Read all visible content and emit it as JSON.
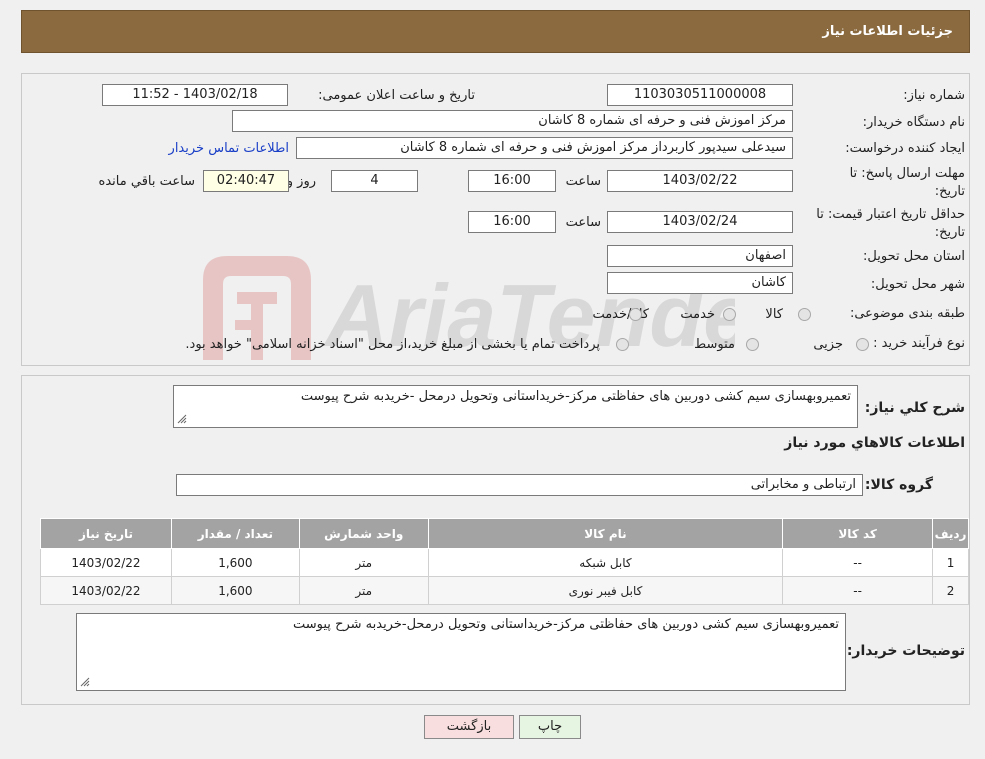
{
  "header": {
    "title": "جزئیات اطلاعات نیاز"
  },
  "details": {
    "need_number_label": "شماره نیاز:",
    "need_number": "1103030511000008",
    "announce_label": "تاریخ و ساعت اعلان عمومی:",
    "announce_value": "1403/02/18 - 11:52",
    "buyer_org_label": "نام دستگاه خریدار:",
    "buyer_org": "مرکز اموزش فنی و حرفه ای شماره 8  کاشان",
    "requester_label": "ایجاد کننده درخواست:",
    "requester": "سیدعلی سیدپور کاربرداز مرکز اموزش فنی و حرفه ای شماره 8  کاشان",
    "contact_link": "اطلاعات تماس خریدار",
    "deadline_label_1": "مهلت ارسال پاسخ: تا",
    "deadline_label_2": "تاریخ:",
    "deadline_date": "1403/02/22",
    "time_label": "ساعت",
    "deadline_time": "16:00",
    "days_value": "4",
    "days_label": "روز و",
    "remaining_time": "02:40:47",
    "remaining_label": "ساعت باقي مانده",
    "validity_label_1": "حداقل تاریخ اعتبار قیمت: تا",
    "validity_label_2": "تاریخ:",
    "validity_date": "1403/02/24",
    "validity_time": "16:00",
    "province_label": "استان محل تحویل:",
    "province": "اصفهان",
    "city_label": "شهر محل تحویل:",
    "city": "کاشان",
    "category_label": "طبقه بندی موضوعی:",
    "category_options": [
      "کالا",
      "خدمت",
      "کالا/خدمت"
    ],
    "process_label": "نوع فرآیند خرید :",
    "process_options": [
      "جزیی",
      "متوسط"
    ],
    "payment_note": "پرداخت تمام یا بخشی از مبلغ خرید،از محل \"اسناد خزانه اسلامی\" خواهد بود."
  },
  "description": {
    "label": "شرح کلي نياز:",
    "text": "تعمیروبهسازی سیم کشی دوربین های حفاظتی مرکز-خریداستانی وتحویل درمحل -خریدبه شرح پیوست"
  },
  "goods": {
    "section_title": "اطلاعات کالاهاي مورد نياز",
    "group_label": "گروه کالا:",
    "group_value": "ارتباطی و مخابراتی",
    "columns": [
      "ردیف",
      "کد کالا",
      "نام کالا",
      "واحد شمارش",
      "تعداد / مقدار",
      "تاریخ نیاز"
    ],
    "rows": [
      [
        "1",
        "--",
        "کابل شبکه",
        "متر",
        "1,600",
        "1403/02/22"
      ],
      [
        "2",
        "--",
        "کابل فیبر نوری",
        "متر",
        "1,600",
        "1403/02/22"
      ]
    ]
  },
  "buyer_notes": {
    "label": "توضیحات خریدار:",
    "text": "تعمیروبهسازی سیم کشی دوربین های حفاظتی مرکز-خریداستانی وتحویل درمحل-خریدبه شرح پیوست"
  },
  "buttons": {
    "print": "چاپ",
    "back": "بازگشت"
  },
  "watermark": {
    "text": "AriaTender.neT"
  },
  "colors": {
    "header_bg": "#8a6a3e",
    "link": "#1a3fc7",
    "back_button_bg": "#f8dede",
    "print_button_bg": "#e6f5e1"
  }
}
